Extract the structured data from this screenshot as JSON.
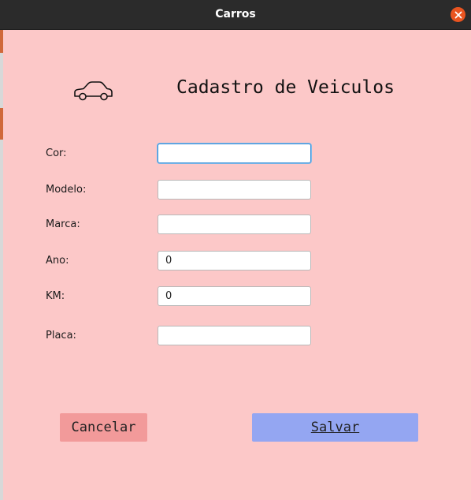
{
  "window": {
    "title": "Carros"
  },
  "form": {
    "title": "Cadastro de Veiculos",
    "icon": "car-icon",
    "fields": [
      {
        "label": "Cor:",
        "value": ""
      },
      {
        "label": "Modelo:",
        "value": ""
      },
      {
        "label": "Marca:",
        "value": ""
      },
      {
        "label": "Ano:",
        "value": "0"
      },
      {
        "label": "KM:",
        "value": "0"
      },
      {
        "label": "Placa:",
        "value": ""
      }
    ]
  },
  "buttons": {
    "cancel_label": "Cancelar",
    "save_label": "Salvar"
  },
  "colors": {
    "background": "#fcc8c8",
    "cancel": "#f29a9a",
    "save": "#94a6f2",
    "close": "#e95420"
  }
}
